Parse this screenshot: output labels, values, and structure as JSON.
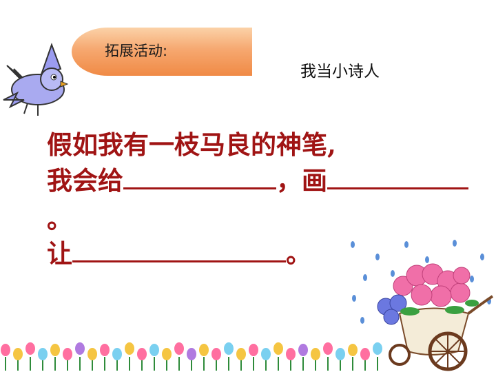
{
  "badge": {
    "label": "拓展活动:"
  },
  "subtitle": "我当小诗人",
  "poem": {
    "line1": "假如我有一枝马良的神笔,",
    "line2_a": "我会给",
    "line2_b": "，画",
    "line3": "。",
    "line4_a": "让",
    "line4_b": "。"
  },
  "colors": {
    "text_red": "#a01414",
    "badge_orange": "#f08a45"
  },
  "icons": [
    "bird-icon",
    "flower-cart-icon",
    "flower-border-icon"
  ]
}
